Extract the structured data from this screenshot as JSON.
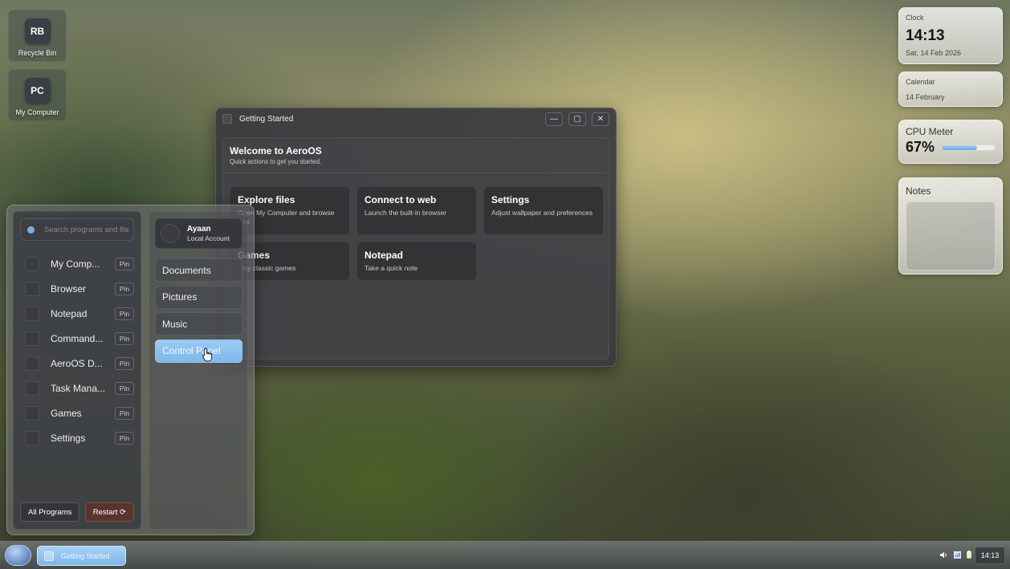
{
  "desktop": {
    "icons": [
      {
        "tile": "RB",
        "label": "Recycle Bin"
      },
      {
        "tile": "PC",
        "label": "My Computer"
      }
    ]
  },
  "widgets": {
    "clock": {
      "title": "Clock",
      "time": "14:13",
      "date": "Sat, 14 Feb 2026"
    },
    "calendar": {
      "title": "Calendar",
      "date": "14 February"
    },
    "cpu": {
      "title": "CPU Meter",
      "value": "67%",
      "level": 0.67
    },
    "notes": {
      "title": "Notes"
    }
  },
  "window": {
    "title": "Getting Started",
    "welcome_title": "Welcome to AeroOS",
    "welcome_subtitle": "Quick actions to get you started.",
    "cards": [
      {
        "title": "Explore files",
        "desc": "Open My Computer and browse files"
      },
      {
        "title": "Connect to web",
        "desc": "Launch the built-in browser"
      },
      {
        "title": "Settings",
        "desc": "Adjust wallpaper and preferences"
      },
      {
        "title": "Games",
        "desc": "Play classic games"
      },
      {
        "title": "Notepad",
        "desc": "Take a quick note"
      }
    ],
    "buttons": {
      "minimize": "—",
      "maximize": "▢",
      "close": "✕"
    }
  },
  "start_menu": {
    "search_placeholder": "Search programs and files",
    "programs": [
      {
        "name": "My Comp...",
        "pin": "Pin"
      },
      {
        "name": "Browser",
        "pin": "Pin"
      },
      {
        "name": "Notepad",
        "pin": "Pin"
      },
      {
        "name": "Command...",
        "pin": "Pin"
      },
      {
        "name": "AeroOS D...",
        "pin": "Pin"
      },
      {
        "name": "Task Mana...",
        "pin": "Pin"
      },
      {
        "name": "Games",
        "pin": "Pin"
      },
      {
        "name": "Settings",
        "pin": "Pin"
      }
    ],
    "all_programs": "All Programs",
    "restart": "Restart ⟳",
    "user": {
      "name": "Ayaan",
      "role": "Local Account"
    },
    "folders": [
      "Documents",
      "Pictures",
      "Music",
      "Control Panel"
    ],
    "active_folder": "Control Panel"
  },
  "taskbar": {
    "task_label": "Getting Started",
    "time": "14:13",
    "tray_icons": [
      "volume-icon",
      "network-icon",
      "battery-icon"
    ]
  }
}
